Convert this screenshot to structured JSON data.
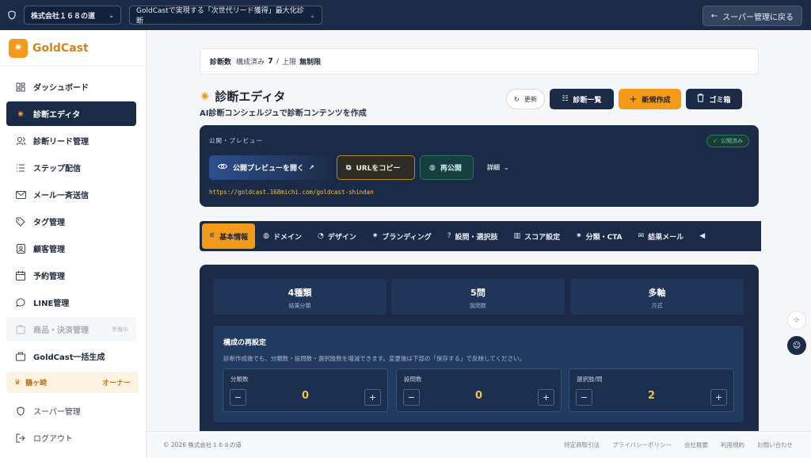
{
  "topbar": {
    "company_select": "株式会社１６８の道",
    "campaign_select": "GoldCastで実現する「次世代リード獲得」最大化診断",
    "back_button": "スーパー管理に戻る"
  },
  "sidebar": {
    "logo": "GoldCast",
    "items": [
      {
        "label": "ダッシュボード",
        "icon": "dashboard-icon"
      },
      {
        "label": "診断エディタ",
        "icon": "sparkle-icon"
      },
      {
        "label": "診断リード管理",
        "icon": "users-icon"
      },
      {
        "label": "ステップ配信",
        "icon": "list-icon"
      },
      {
        "label": "メール一斉送信",
        "icon": "mail-icon"
      },
      {
        "label": "タグ管理",
        "icon": "tag-icon"
      },
      {
        "label": "顧客管理",
        "icon": "contact-icon"
      },
      {
        "label": "予約管理",
        "icon": "calendar-icon"
      },
      {
        "label": "LINE管理",
        "icon": "chat-icon"
      },
      {
        "label": "商品・決済管理",
        "icon": "cart-icon",
        "badge": "準備中"
      },
      {
        "label": "GoldCast一括生成",
        "icon": "package-icon"
      }
    ],
    "owner": {
      "name": "鶴ヶ崎",
      "role": "オーナー"
    },
    "super_admin": "スーパー管理",
    "logout": "ログアウト"
  },
  "main": {
    "count": {
      "label": "診断数",
      "configured": "構成済み",
      "value": "7",
      "sep": "/",
      "limit_label": "上限",
      "limit": "無制限"
    },
    "title": "診断エディタ",
    "subtitle": "AI診断コンシェルジュで診断コンテンツを作成",
    "buttons": {
      "refresh": "更新",
      "list": "診断一覧",
      "new": "新規作成",
      "trash": "ゴミ箱"
    },
    "publish": {
      "label": "公開・プレビュー",
      "status": "公開済み",
      "open_preview": "公開プレビューを開く",
      "copy_url": "URLをコピー",
      "republish": "再公開",
      "detail": "詳細",
      "url": "https://goldcast.168michi.com/goldcast-shindan"
    },
    "tabs": [
      "基本情報",
      "ドメイン",
      "デザイン",
      "ブランディング",
      "設問・選択肢",
      "スコア設定",
      "分類・CTA",
      "結果メール"
    ],
    "stats": [
      {
        "value": "4種類",
        "label": "結果分類"
      },
      {
        "value": "5問",
        "label": "設問数"
      },
      {
        "value": "多軸",
        "label": "方式"
      }
    ],
    "reset": {
      "title": "構成の再設定",
      "desc": "診断作成後でも、分類数・設問数・選択肢数を増減できます。変更後は下部の「保存する」で反映してください。",
      "steppers": [
        {
          "label": "分類数",
          "value": "0"
        },
        {
          "label": "設問数",
          "value": "0"
        },
        {
          "label": "選択肢/問",
          "value": "2"
        }
      ]
    }
  },
  "footer": {
    "copyright": "© 2026 株式会社１６８の道",
    "links": [
      "特定商取引法",
      "プライバシーポリシー",
      "会社概要",
      "利用規約",
      "お問い合わせ"
    ]
  }
}
